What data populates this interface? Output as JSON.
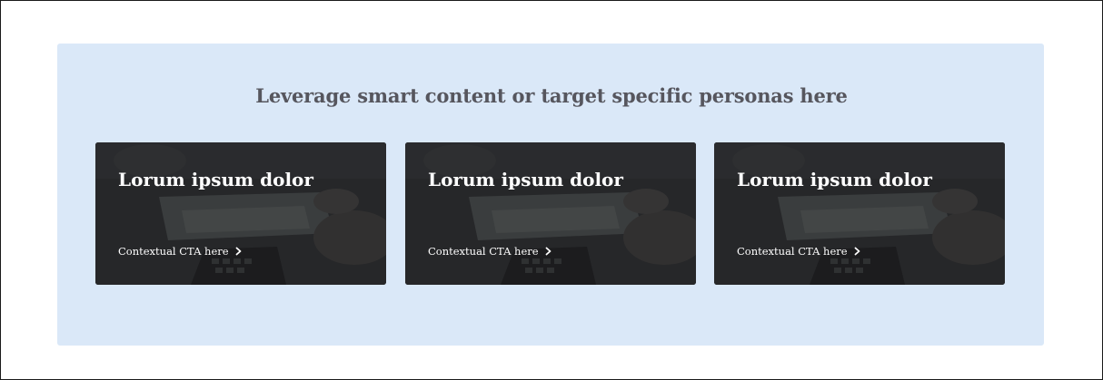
{
  "section": {
    "heading": "Leverage smart content or target specific personas here",
    "background_color": "#dae8f8",
    "heading_color": "#56565e"
  },
  "cards": [
    {
      "title": "Lorum ipsum dolor",
      "cta_label": "Contextual CTA here",
      "cta_icon": "chevron-right-icon",
      "image": "office-desk-laptop-photo"
    },
    {
      "title": "Lorum ipsum dolor",
      "cta_label": "Contextual CTA here",
      "cta_icon": "chevron-right-icon",
      "image": "office-desk-laptop-photo"
    },
    {
      "title": "Lorum ipsum dolor",
      "cta_label": "Contextual CTA here",
      "cta_icon": "chevron-right-icon",
      "image": "office-desk-laptop-photo"
    }
  ]
}
